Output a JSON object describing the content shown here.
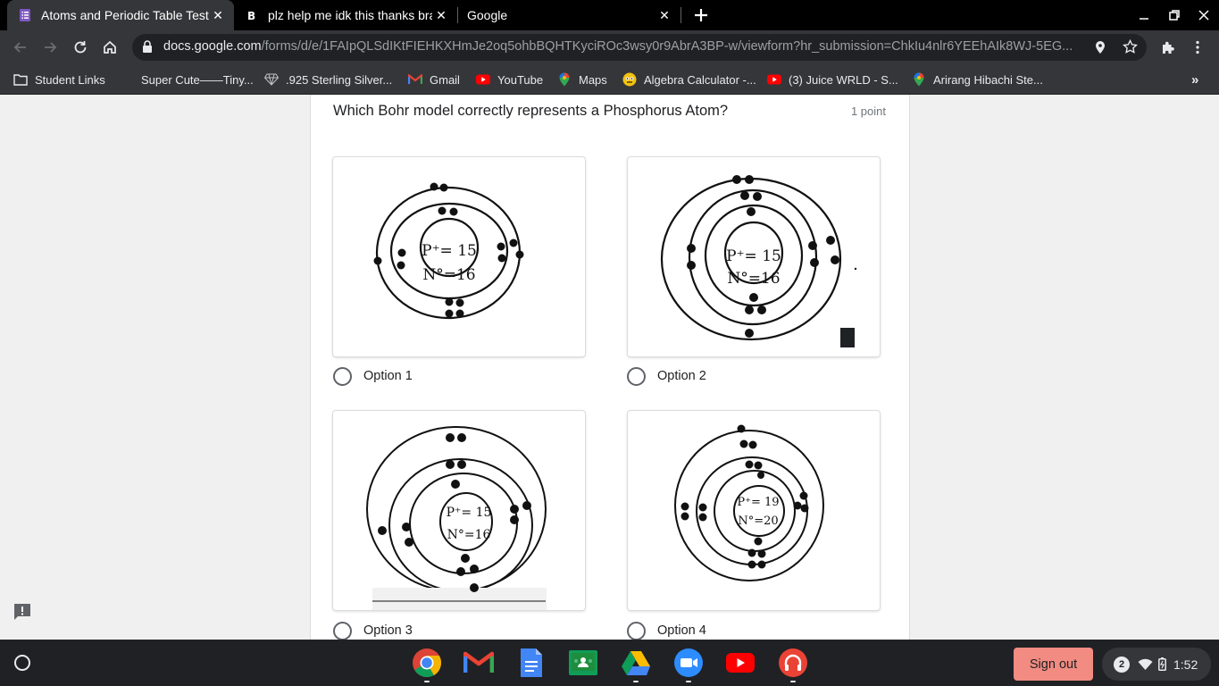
{
  "tabs": [
    {
      "title": "Atoms and Periodic Table Test",
      "active": true,
      "icon": "google-forms-icon"
    },
    {
      "title": "plz help me idk this thanks brainl",
      "active": false,
      "icon": "brainly-icon"
    },
    {
      "title": "Google",
      "active": false,
      "icon": "none"
    }
  ],
  "omnibox": {
    "host": "docs.google.com",
    "path": "/forms/d/e/1FAIpQLSdIKtFIEHKXHmJe2oq5ohbBQHTKyciROc3wsy0r9AbrA3BP-w/viewform?hr_submission=ChkIu4nlr6YEEhAIk8WJ-5EG..."
  },
  "bookmarks": [
    {
      "label": "Student Links",
      "icon": "folder-icon"
    },
    {
      "label": "Super Cute——Tiny...",
      "icon": "none"
    },
    {
      "label": ".925 Sterling Silver...",
      "icon": "diamond-icon"
    },
    {
      "label": "Gmail",
      "icon": "gmail-icon"
    },
    {
      "label": "YouTube",
      "icon": "youtube-icon"
    },
    {
      "label": "Maps",
      "icon": "maps-pin-icon"
    },
    {
      "label": "Algebra Calculator -...",
      "icon": "calculator-icon"
    },
    {
      "label": "(3) Juice WRLD - S...",
      "icon": "youtube-icon"
    },
    {
      "label": "Arirang Hibachi Ste...",
      "icon": "maps-pin-icon"
    }
  ],
  "bookmarks_overflow": "»",
  "question": {
    "title": "Which Bohr model correctly represents a Phosphorus Atom?",
    "points": "1 point",
    "options": [
      {
        "label": "Option 1",
        "proton_text": "P⁺= 15",
        "neutron_text": "N°=16"
      },
      {
        "label": "Option 2",
        "proton_text": "P⁺= 15",
        "neutron_text": "N°=16"
      },
      {
        "label": "Option 3",
        "proton_text": "P⁺= 15",
        "neutron_text": "N°=16"
      },
      {
        "label": "Option 4",
        "proton_text": "P⁺= 19",
        "neutron_text": "N°=20"
      }
    ]
  },
  "shelf": {
    "apps": [
      "chrome-icon",
      "gmail-icon",
      "docs-icon",
      "classroom-icon",
      "drive-icon",
      "zoom-icon",
      "youtube-icon",
      "headphones-icon"
    ],
    "sign_out": "Sign out",
    "notification_count": "2",
    "time": "1:52"
  },
  "colors": {
    "forms_purple": "#673ab7",
    "signout": "#f28b82",
    "youtube_red": "#ff0000"
  }
}
